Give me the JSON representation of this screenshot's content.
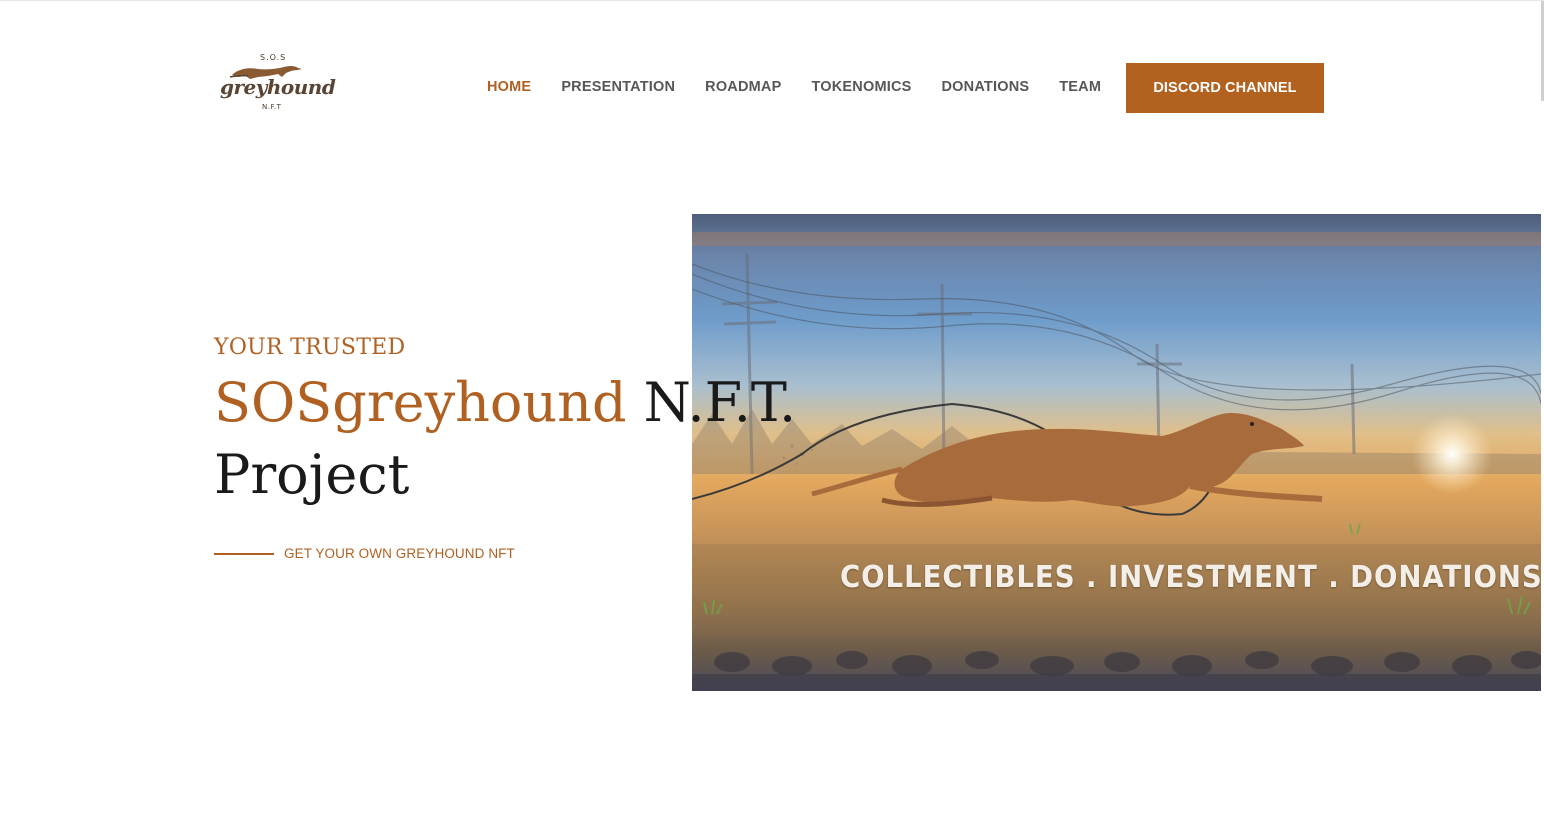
{
  "logo": {
    "top_text": "S.O.S",
    "word": "greyhound",
    "bottom_text": "N.F.T",
    "icon": "greyhound-dog-logo"
  },
  "nav": {
    "items": [
      {
        "label": "HOME",
        "active": true
      },
      {
        "label": "PRESENTATION",
        "active": false
      },
      {
        "label": "ROADMAP",
        "active": false
      },
      {
        "label": "TOKENOMICS",
        "active": false
      },
      {
        "label": "DONATIONS",
        "active": false
      },
      {
        "label": "TEAM",
        "active": false
      }
    ],
    "cta_label": "DISCORD CHANNEL"
  },
  "hero": {
    "eyebrow": "YOUR TRUSTED",
    "headline_accent": "SOSgreyhound",
    "headline_rest": " N.F.T. Project",
    "cta": "GET YOUR OWN GREYHOUND NFT",
    "image_caption": "COLLECTIBLES . INVESTMENT . DONATIONS"
  },
  "colors": {
    "accent": "#b06122",
    "button": "#b2611f",
    "text_dark": "#1a1a1a",
    "nav_text": "#575757"
  }
}
